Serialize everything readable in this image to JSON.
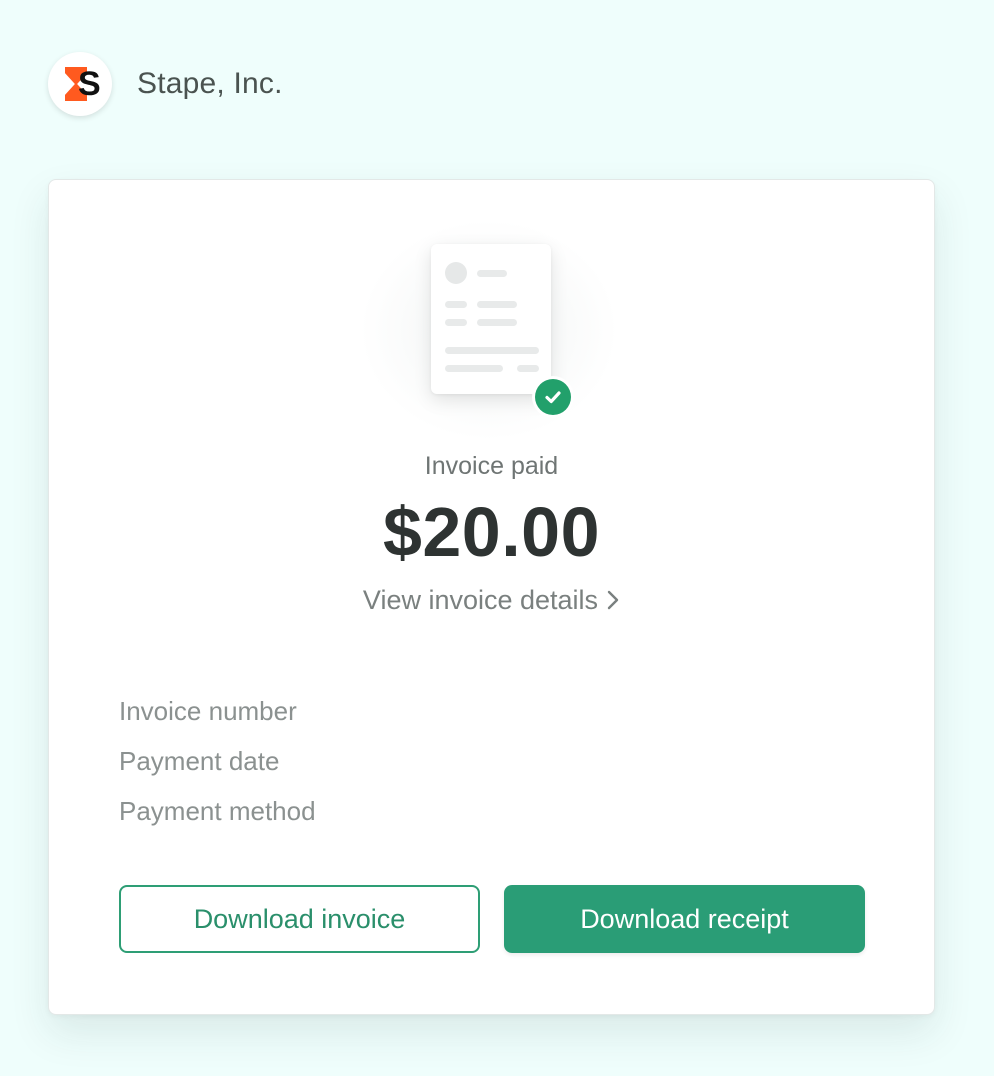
{
  "header": {
    "logo_letter": "S",
    "company_name": "Stape, Inc."
  },
  "invoice": {
    "status": "Invoice paid",
    "amount": "$20.00",
    "details_link": "View invoice details"
  },
  "info_labels": [
    "Invoice number",
    "Payment date",
    "Payment method"
  ],
  "actions": {
    "download_invoice": "Download invoice",
    "download_receipt": "Download receipt"
  },
  "colors": {
    "background": "#effefc",
    "accent_green": "#2a9d76",
    "logo_orange": "#ff5a1f"
  },
  "icons": {
    "logo": "stape-logo-icon",
    "document": "invoice-document-icon",
    "check": "check-circle-icon",
    "chevron": "chevron-right-icon"
  }
}
